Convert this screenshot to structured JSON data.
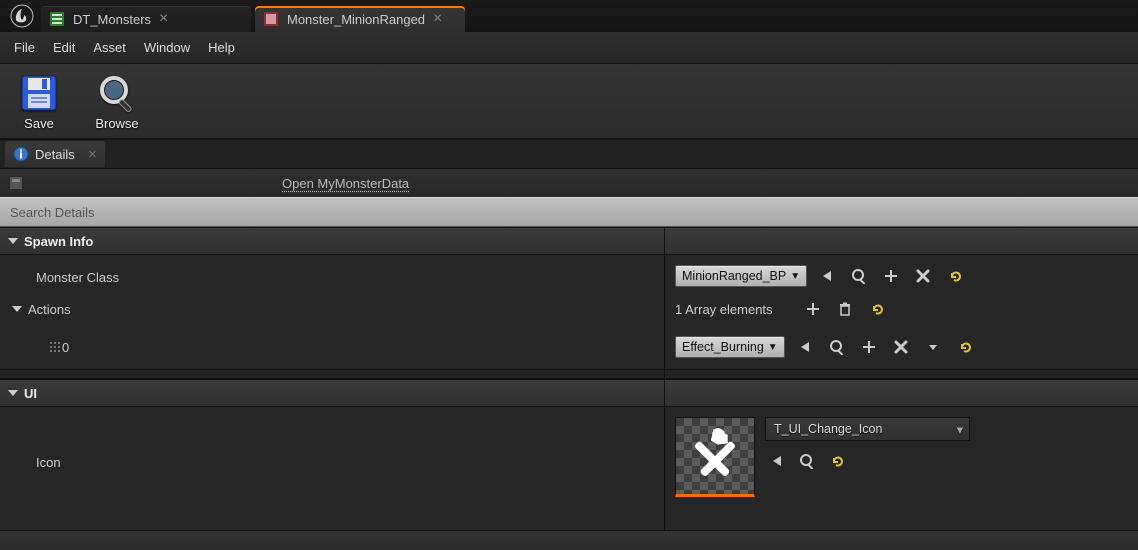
{
  "tabs": {
    "doc0": {
      "label": "DT_Monsters"
    },
    "doc1": {
      "label": "Monster_MinionRanged"
    }
  },
  "menu": {
    "file": "File",
    "edit": "Edit",
    "asset": "Asset",
    "window": "Window",
    "help": "Help"
  },
  "toolbar": {
    "save": "Save",
    "browse": "Browse"
  },
  "panel": {
    "details": "Details"
  },
  "classRow": {
    "openLink": "Open MyMonsterData"
  },
  "search": {
    "placeholder": "Search Details"
  },
  "categories": {
    "spawn": "Spawn Info",
    "ui": "UI"
  },
  "props": {
    "monster_class_label": "Monster Class",
    "monster_class_value": "MinionRanged_BP",
    "actions_label": "Actions",
    "actions_count_text": "1 Array elements",
    "action0_index": "0",
    "action0_value": "Effect_Burning",
    "icon_label": "Icon",
    "icon_asset": "T_UI_Change_Icon"
  }
}
